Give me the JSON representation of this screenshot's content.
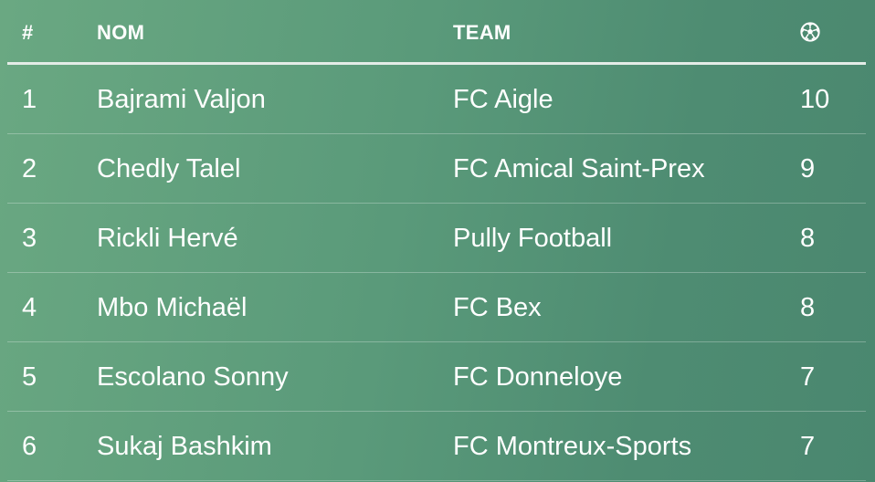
{
  "header": {
    "rank_label": "#",
    "name_label": "NOM",
    "team_label": "TEAM",
    "goals_icon": "soccer-ball-icon"
  },
  "rows": [
    {
      "rank": "1",
      "name": "Bajrami Valjon",
      "team": "FC Aigle",
      "goals": "10"
    },
    {
      "rank": "2",
      "name": "Chedly Talel",
      "team": "FC Amical Saint-Prex",
      "goals": "9"
    },
    {
      "rank": "3",
      "name": "Rickli Hervé",
      "team": "Pully Football",
      "goals": "8"
    },
    {
      "rank": "4",
      "name": "Mbo Michaël",
      "team": "FC Bex",
      "goals": "8"
    },
    {
      "rank": "5",
      "name": "Escolano Sonny",
      "team": "FC Donneloye",
      "goals": "7"
    },
    {
      "rank": "6",
      "name": "Sukaj Bashkim",
      "team": "FC Montreux-Sports",
      "goals": "7"
    }
  ],
  "colors": {
    "background_start": "#6aa882",
    "background_end": "#4a876f",
    "text": "#ffffff"
  }
}
